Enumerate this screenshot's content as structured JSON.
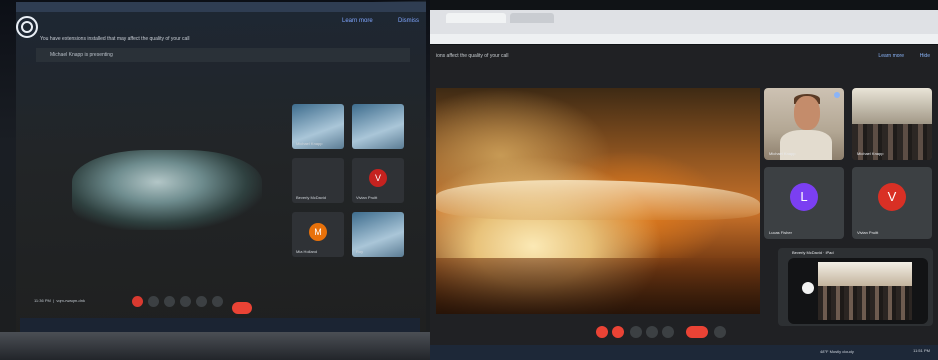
{
  "left_panel": {
    "notice": "You have extensions installed that may affect the quality of your call",
    "learn_more": "Learn more",
    "dismiss": "Dismiss",
    "presenting": "Michael Knapp is presenting",
    "time": "11:36 PM",
    "meeting_code": "vqm-rwaqm-dnk",
    "tiles": [
      {
        "name": "Michael Knapp",
        "initial": ""
      },
      {
        "name": "",
        "initial": ""
      },
      {
        "name": "Beverly McDavid",
        "initial": ""
      },
      {
        "name": "Vivian Pruitt",
        "initial": "V",
        "color": "#c5221f"
      },
      {
        "name": "Mia Holland",
        "initial": "M",
        "color": "#e8710a"
      },
      {
        "name": "Roy",
        "initial": ""
      }
    ]
  },
  "right_panel": {
    "notice": "ions affect the quality of your call",
    "learn_more": "Learn more",
    "hide": "Hide",
    "tiles": [
      {
        "name": "Michael Knapp",
        "initial": ""
      },
      {
        "name": "Michael Knapp",
        "initial": ""
      },
      {
        "name": "Lucas Fisher",
        "initial": "L",
        "color": "#7b3ff2"
      },
      {
        "name": "Vivian Pruitt",
        "initial": "V",
        "color": "#d93025"
      }
    ],
    "phone_header": "Beverly McDavid · iPad",
    "weather": "48°F Mostly cloudy",
    "clock": "11:51 PM"
  }
}
